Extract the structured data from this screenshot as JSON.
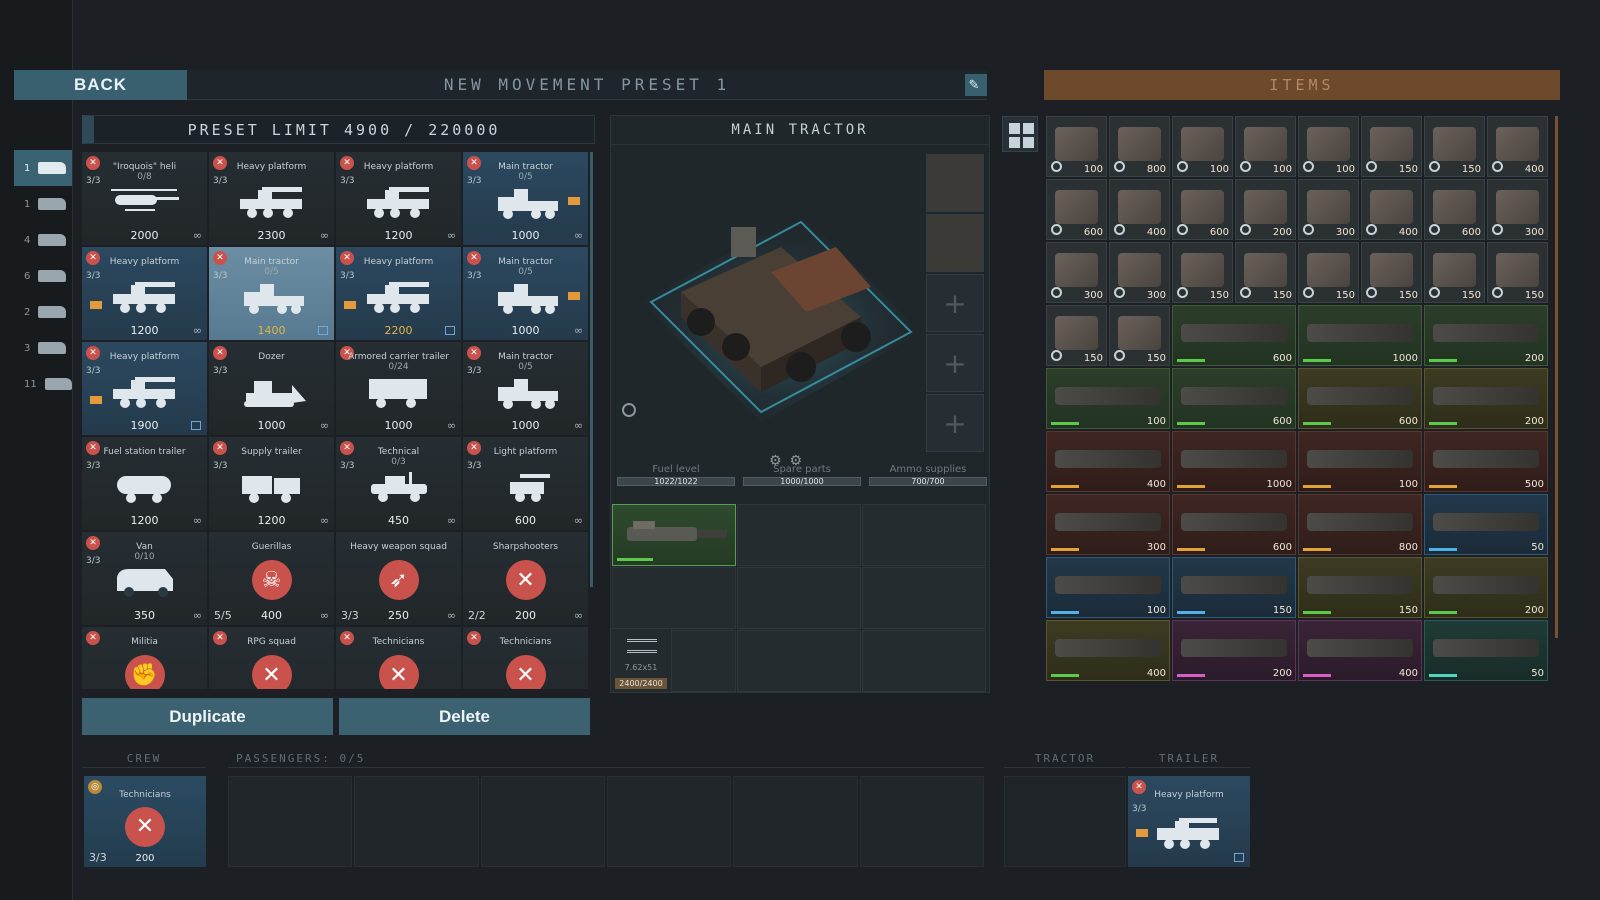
{
  "topbar": {
    "back_label": "BACK",
    "preset_title": "NEW MOVEMENT PRESET 1",
    "items_label": "ITEMS"
  },
  "categories": [
    {
      "count": "1",
      "icon": "helicopter-icon",
      "selected": true
    },
    {
      "count": "1",
      "icon": "truck-icon"
    },
    {
      "count": "4",
      "icon": "tank-icon"
    },
    {
      "count": "6",
      "icon": "armored-vehicle-icon"
    },
    {
      "count": "2",
      "icon": "trailer-truck-icon"
    },
    {
      "count": "3",
      "icon": "car-icon"
    },
    {
      "count": "11",
      "icon": "infantry-icon"
    }
  ],
  "preset_limit": "PRESET LIMIT 4900 / 220000",
  "units": [
    {
      "name": "\"Iroquois\" heli",
      "count": "3/3",
      "sub": "0/8",
      "cost": "2000",
      "art": "heli",
      "style": "dark"
    },
    {
      "name": "Heavy platform",
      "count": "3/3",
      "cost": "2300",
      "art": "platform",
      "style": "dark"
    },
    {
      "name": "Heavy platform",
      "count": "3/3",
      "cost": "1200",
      "art": "platform",
      "style": "dark"
    },
    {
      "name": "Main tractor",
      "count": "3/3",
      "sub": "0/5",
      "cost": "1000",
      "art": "tractor",
      "style": "blue",
      "flagr": true
    },
    {
      "name": "Heavy platform",
      "count": "3/3",
      "cost": "1200",
      "art": "platform",
      "style": "blue",
      "flag": true
    },
    {
      "name": "Main tractor",
      "count": "3/3",
      "sub": "0/5",
      "cost": "1400",
      "art": "tractor",
      "style": "sel",
      "yellow": true,
      "badge": true
    },
    {
      "name": "Heavy platform",
      "count": "3/3",
      "cost": "2200",
      "art": "platform",
      "style": "blue",
      "yellow": true,
      "flag": true,
      "badge": true
    },
    {
      "name": "Main tractor",
      "count": "3/3",
      "sub": "0/5",
      "cost": "1000",
      "art": "tractor",
      "style": "blue",
      "flagr": true
    },
    {
      "name": "Heavy platform",
      "count": "3/3",
      "cost": "1900",
      "art": "platform",
      "style": "blue",
      "flag": true,
      "badge": true
    },
    {
      "name": "Dozer",
      "count": "3/3",
      "cost": "1000",
      "art": "dozer",
      "style": "dark"
    },
    {
      "name": "Armored carrier trailer",
      "count": "",
      "sub": "0/24",
      "cost": "1000",
      "art": "carrier",
      "style": "dark"
    },
    {
      "name": "Main tractor",
      "count": "3/3",
      "sub": "0/5",
      "cost": "1000",
      "art": "tractor",
      "style": "dark"
    },
    {
      "name": "Fuel station trailer",
      "count": "3/3",
      "cost": "1200",
      "art": "fuel",
      "style": "dark"
    },
    {
      "name": "Supply trailer",
      "count": "3/3",
      "cost": "1200",
      "art": "supply",
      "style": "dark"
    },
    {
      "name": "Technical",
      "count": "3/3",
      "sub": "0/3",
      "cost": "450",
      "art": "technical",
      "style": "dark"
    },
    {
      "name": "Light platform",
      "count": "3/3",
      "cost": "600",
      "art": "light",
      "style": "dark"
    },
    {
      "name": "Van",
      "count": "3/3",
      "sub": "0/10",
      "cost": "350",
      "art": "van",
      "style": "dark"
    },
    {
      "name": "Guerillas",
      "squad": "5/5",
      "cost": "400",
      "art": "skull",
      "style": "dark"
    },
    {
      "name": "Heavy weapon squad",
      "squad": "3/3",
      "cost": "250",
      "art": "rockets",
      "style": "dark"
    },
    {
      "name": "Sharpshooters",
      "squad": "2/2",
      "cost": "200",
      "art": "rifle",
      "style": "dark"
    },
    {
      "name": "Militia",
      "count": "",
      "cost": "",
      "art": "fist",
      "style": "dark"
    },
    {
      "name": "RPG squad",
      "count": "",
      "cost": "",
      "art": "rpg",
      "style": "dark"
    },
    {
      "name": "Technicians",
      "count": "",
      "cost": "",
      "art": "tools",
      "style": "dark"
    },
    {
      "name": "Technicians",
      "count": "",
      "cost": "",
      "art": "tools",
      "style": "dark"
    }
  ],
  "buttons": {
    "duplicate": "Duplicate",
    "delete": "Delete"
  },
  "tractor": {
    "title": "MAIN TRACTOR",
    "fuel_label": "Fuel level",
    "fuel_value": "1022/1022",
    "spare_label": "Spare parts",
    "spare_value": "1000/1000",
    "ammo_label": "Ammo supplies",
    "ammo_value": "700/700",
    "ammo_caliber": "7.62x51",
    "ammo_amount": "2400/2400"
  },
  "items": [
    [
      {
        "v": "100",
        "t": "small",
        "c": "grey"
      },
      {
        "v": "800",
        "t": "small",
        "c": "grey"
      },
      {
        "v": "100",
        "t": "small",
        "c": "grey"
      },
      {
        "v": "100",
        "t": "small",
        "c": "grey"
      },
      {
        "v": "100",
        "t": "small",
        "c": "grey"
      },
      {
        "v": "150",
        "t": "small",
        "c": "grey"
      },
      {
        "v": "150",
        "t": "small",
        "c": "grey"
      },
      {
        "v": "400",
        "t": "small",
        "c": "grey"
      }
    ],
    [
      {
        "v": "600",
        "t": "small",
        "c": "grey"
      },
      {
        "v": "400",
        "t": "small",
        "c": "grey"
      },
      {
        "v": "600",
        "t": "small",
        "c": "grey"
      },
      {
        "v": "200",
        "t": "small",
        "c": "grey"
      },
      {
        "v": "300",
        "t": "small",
        "c": "grey"
      },
      {
        "v": "400",
        "t": "small",
        "c": "grey"
      },
      {
        "v": "600",
        "t": "small",
        "c": "grey"
      },
      {
        "v": "300",
        "t": "small",
        "c": "grey"
      }
    ],
    [
      {
        "v": "300",
        "t": "small",
        "c": "grey"
      },
      {
        "v": "300",
        "t": "small",
        "c": "grey"
      },
      {
        "v": "150",
        "t": "small",
        "c": "grey"
      },
      {
        "v": "150",
        "t": "small",
        "c": "grey"
      },
      {
        "v": "150",
        "t": "small",
        "c": "grey"
      },
      {
        "v": "150",
        "t": "small",
        "c": "grey"
      },
      {
        "v": "150",
        "t": "small",
        "c": "grey"
      },
      {
        "v": "150",
        "t": "small",
        "c": "grey"
      }
    ],
    [
      {
        "v": "150",
        "t": "small",
        "c": "grey"
      },
      {
        "v": "150",
        "t": "small",
        "c": "grey"
      },
      {
        "v": "600",
        "t": "big",
        "c": "green"
      },
      {
        "v": "1000",
        "t": "big",
        "c": "green"
      },
      {
        "v": "200",
        "t": "big",
        "c": "green"
      }
    ],
    [
      {
        "v": "100",
        "t": "big",
        "c": "green"
      },
      {
        "v": "600",
        "t": "big",
        "c": "green"
      },
      {
        "v": "600",
        "t": "big",
        "c": "olive"
      },
      {
        "v": "200",
        "t": "big",
        "c": "olive"
      }
    ],
    [
      {
        "v": "400",
        "t": "big",
        "c": "red"
      },
      {
        "v": "1000",
        "t": "big",
        "c": "red"
      },
      {
        "v": "100",
        "t": "big",
        "c": "red"
      },
      {
        "v": "500",
        "t": "big",
        "c": "red"
      }
    ],
    [
      {
        "v": "300",
        "t": "big",
        "c": "red"
      },
      {
        "v": "600",
        "t": "big",
        "c": "red"
      },
      {
        "v": "800",
        "t": "big",
        "c": "red"
      },
      {
        "v": "50",
        "t": "big",
        "c": "blue"
      }
    ],
    [
      {
        "v": "100",
        "t": "big",
        "c": "blue"
      },
      {
        "v": "150",
        "t": "big",
        "c": "blue"
      },
      {
        "v": "150",
        "t": "big",
        "c": "olive"
      },
      {
        "v": "200",
        "t": "big",
        "c": "olive"
      }
    ],
    [
      {
        "v": "400",
        "t": "big",
        "c": "olive"
      },
      {
        "v": "200",
        "t": "big",
        "c": "purple"
      },
      {
        "v": "400",
        "t": "big",
        "c": "purple"
      },
      {
        "v": "50",
        "t": "big",
        "c": "teal"
      }
    ]
  ],
  "bottom": {
    "crew_label": "CREW",
    "passengers_label": "PASSENGERS: 0/5",
    "tractor_label": "TRACTOR",
    "trailer_label": "TRAILER",
    "crew_unit": {
      "name": "Technicians",
      "squad": "3/3",
      "cost": "200"
    },
    "trailer_unit": {
      "name": "Heavy platform",
      "count": "3/3"
    }
  },
  "colors": {
    "accent": "#38606e",
    "items_header": "#6e4a2c",
    "cost_highlight": "#e2b445",
    "unit_icon": "#c9534c"
  }
}
